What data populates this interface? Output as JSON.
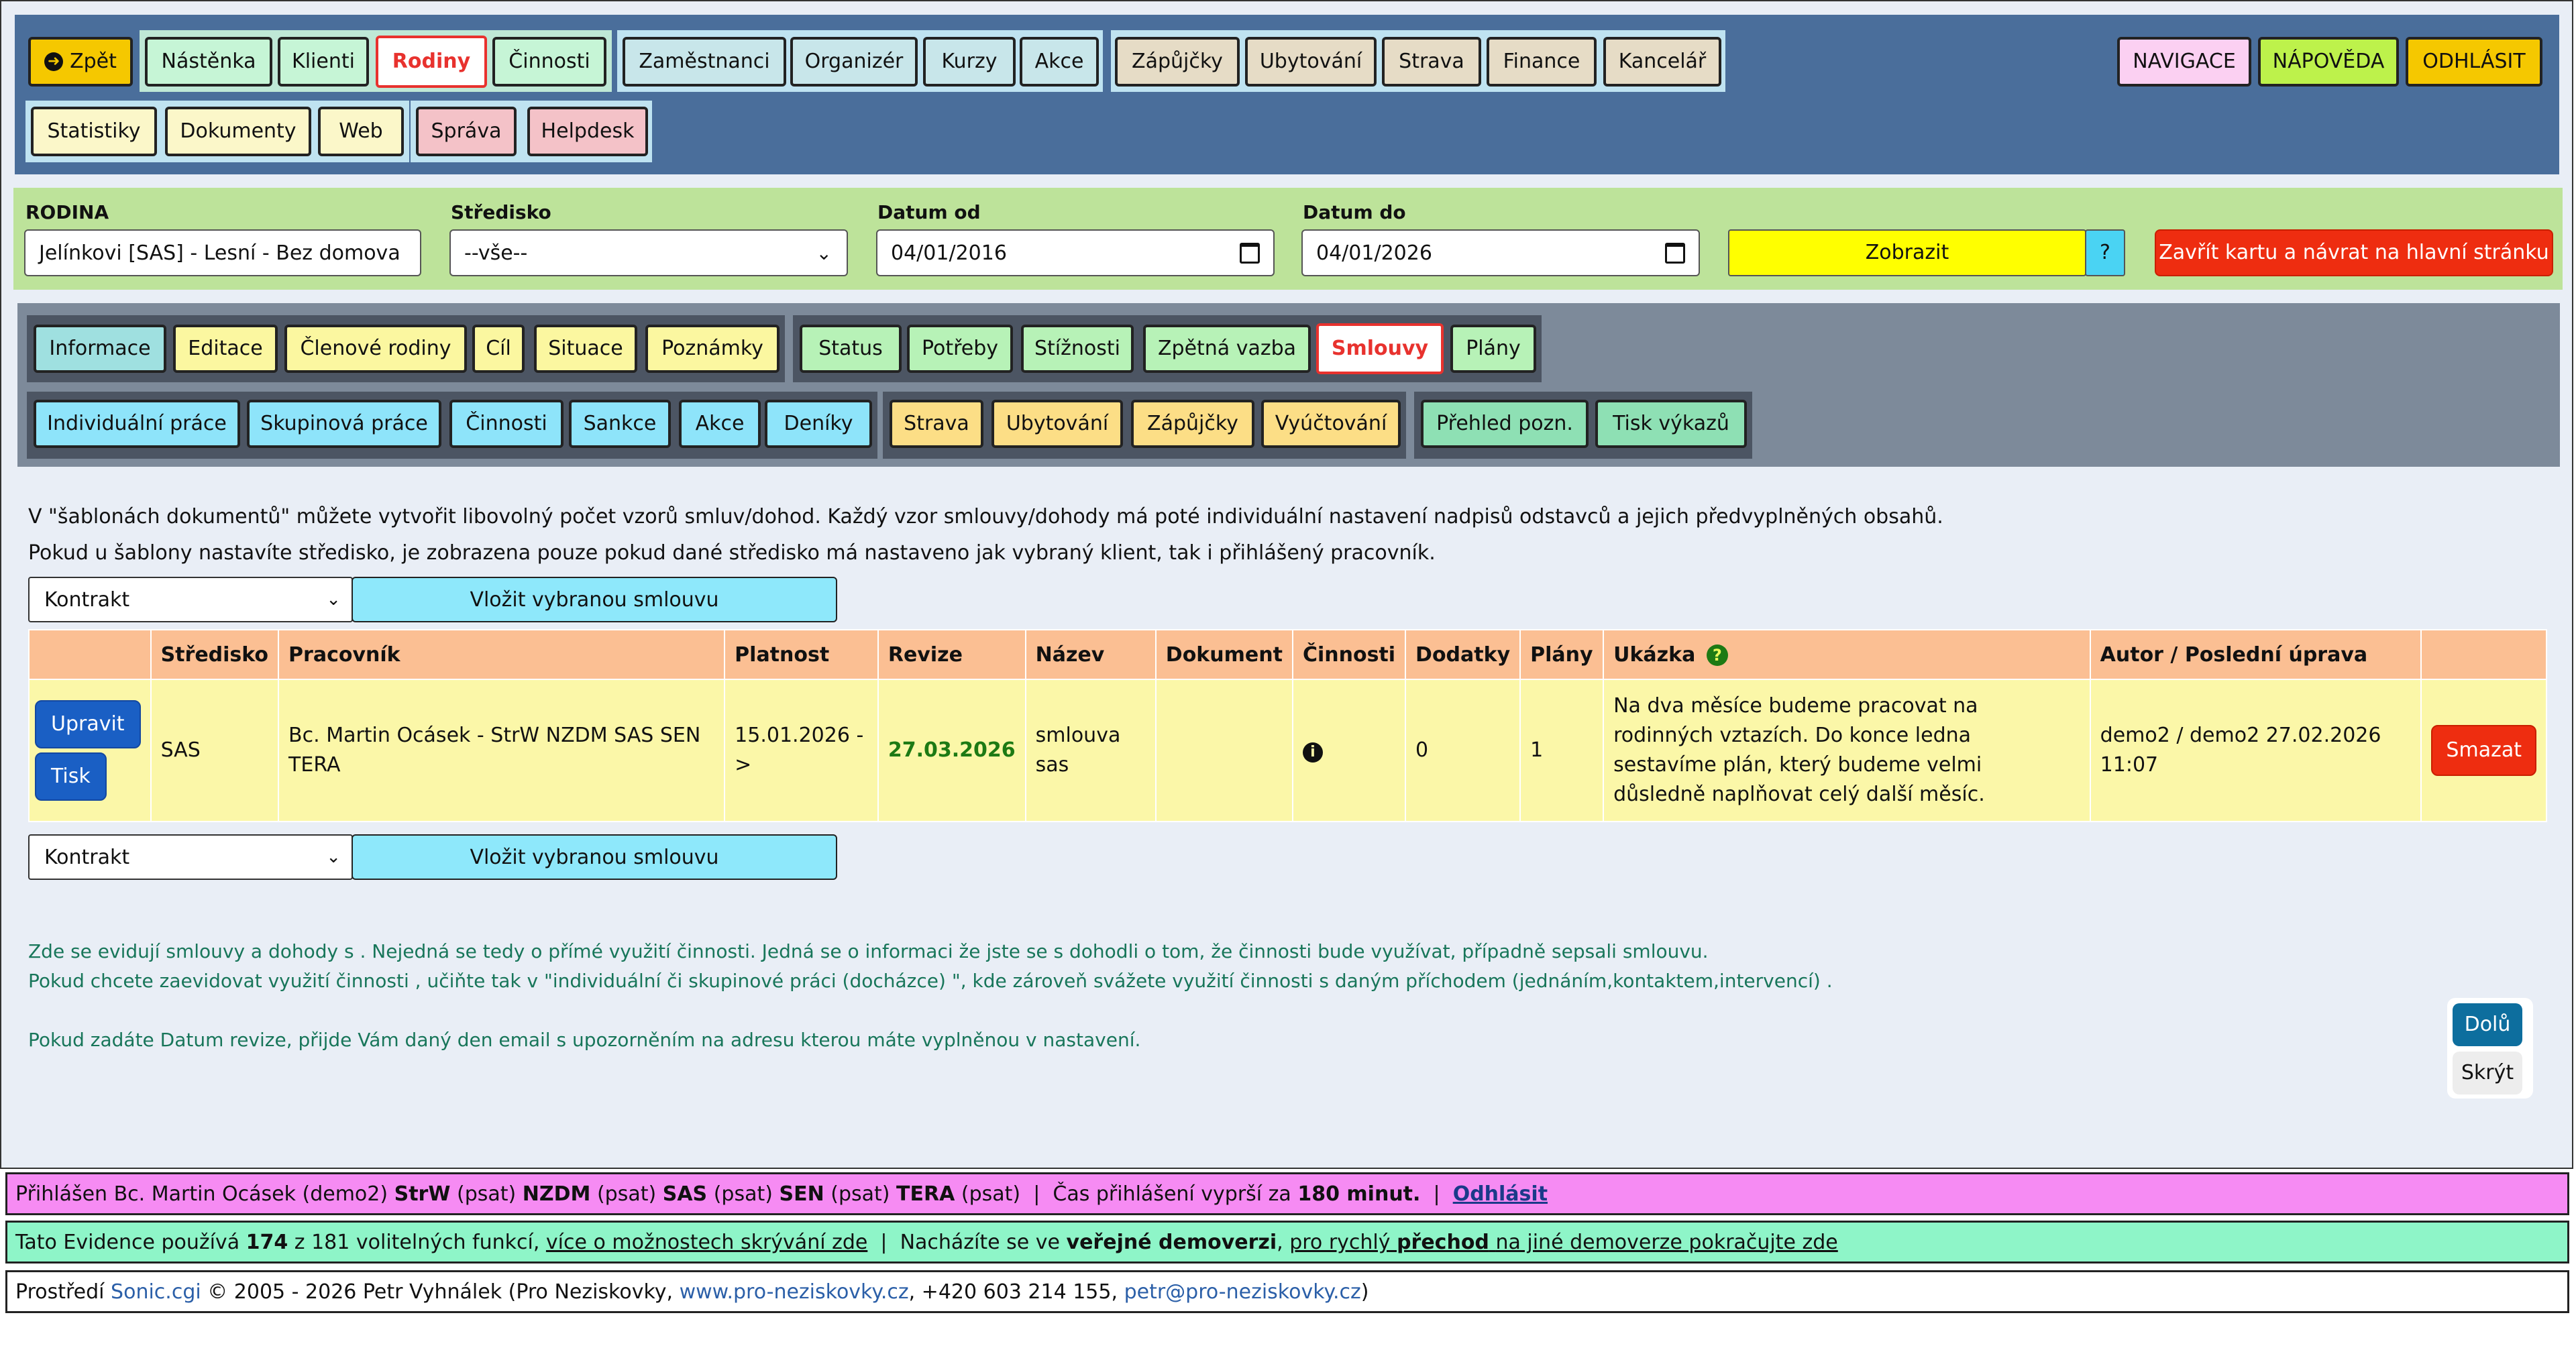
{
  "colors": {
    "nav_bg": "#4a6e9b",
    "filter_bg": "#bde39a",
    "tab_bg": "#7d8a9a",
    "active_red": "#e8322e",
    "table_head": "#fbbf93",
    "table_row": "#fbf7a8"
  },
  "topnav": {
    "back": "Zpět",
    "group1": [
      "Nástěnka",
      "Klienti",
      "Rodiny",
      "Činnosti"
    ],
    "group2": [
      "Zaměstnanci",
      "Organizér",
      "Kurzy",
      "Akce"
    ],
    "group3": [
      "Zápůjčky",
      "Ubytování",
      "Strava",
      "Finance",
      "Kancelář"
    ],
    "group4": [
      "Statistiky",
      "Dokumenty",
      "Web"
    ],
    "group5": [
      "Správa",
      "Helpdesk"
    ],
    "right": [
      "NAVIGACE",
      "NÁPOVĚDA",
      "ODHLÁSIT"
    ]
  },
  "filter": {
    "family_label": "RODINA",
    "family_value": "Jelínkovi [SAS] - Lesní - Bez domova",
    "center_label": "Středisko",
    "center_value": "--vše--",
    "date_from_label": "Datum od",
    "date_from_value": "04/01/2016",
    "date_to_label": "Datum do",
    "date_to_value": "04/01/2026",
    "show_button": "Zobrazit",
    "help_button": "?",
    "close_button": "Zavřít kartu a návrat na hlavní stránku"
  },
  "tabs": {
    "row1_a": [
      "Informace",
      "Editace",
      "Členové rodiny",
      "Cíl",
      "Situace",
      "Poznámky"
    ],
    "row1_b": [
      "Status",
      "Potřeby",
      "Stížnosti",
      "Zpětná vazba",
      "Smlouvy",
      "Plány"
    ],
    "row2_a": [
      "Individuální práce",
      "Skupinová práce",
      "Činnosti",
      "Sankce",
      "Akce",
      "Deníky"
    ],
    "row2_b": [
      "Strava",
      "Ubytování",
      "Zápůjčky",
      "Vyúčtování"
    ],
    "row2_c": [
      "Přehled pozn.",
      "Tisk výkazů"
    ]
  },
  "intro": {
    "line1": "V \"šablonách dokumentů\" můžete vytvořit libovolný počet vzorů smluv/dohod. Každý vzor smlouvy/dohody má poté individuální nastavení nadpisů odstavců a jejich předvyplněných obsahů.",
    "line2": "Pokud u šablony nastavíte středisko, je zobrazena pouze pokud dané středisko má nastaveno jak vybraný klient, tak i přihlášený pracovník."
  },
  "contract_select": {
    "value": "Kontrakt",
    "insert": "Vložit vybranou smlouvu"
  },
  "table": {
    "headers": [
      "",
      "Středisko",
      "Pracovník",
      "Platnost",
      "Revize",
      "Název",
      "Dokument",
      "Činnosti",
      "Dodatky",
      "Plány",
      "Ukázka",
      "Autor / Poslední úprava",
      ""
    ],
    "row": {
      "edit": "Upravit",
      "print": "Tisk",
      "center": "SAS",
      "worker": "Bc. Martin Ocásek - StrW NZDM SAS SEN TERA",
      "validity": "15.01.2026 - >",
      "revision": "27.03.2026",
      "name": "smlouva sas",
      "document": "",
      "addenda": "0",
      "plans": "1",
      "preview": "Na dva měsíce budeme pracovat na rodinných vztazích. Do konce ledna sestavíme plán, který budeme velmi důsledně naplňovat celý další měsíc.",
      "author": "demo2 / demo2 27.02.2026 11:07",
      "delete": "Smazat"
    }
  },
  "notes": {
    "n1": "Zde se evidují smlouvy a dohody s . Nejedná se tedy o přímé využití činnosti. Jedná se o informaci že jste se s dohodli o tom, že činnosti bude využívat, případně sepsali smlouvu.",
    "n2": "Pokud chcete zaevidovat využití činnosti , učiňte tak v \"individuální či skupinové práci (docházce) \", kde zároveň svážete využití činnosti s daným příchodem (jednáním,kontaktem,intervencí) .",
    "n3": "Pokud zadáte Datum revize, přijde Vám daný den email s upozorněním na adresu kterou máte vyplněnou v nastavení."
  },
  "side": {
    "down": "Dolů",
    "hide": "Skrýt"
  },
  "footer": {
    "login_pre": "Přihlášen Bc. Martin Ocásek (demo2)",
    "roles": [
      {
        "b": "StrW",
        "t": "(psat)"
      },
      {
        "b": "NZDM",
        "t": "(psat)"
      },
      {
        "b": "SAS",
        "t": "(psat)"
      },
      {
        "b": "SEN",
        "t": "(psat)"
      },
      {
        "b": "TERA",
        "t": "(psat)"
      }
    ],
    "sep": "|",
    "expire_pre": "Čas přihlášení vyprší za",
    "expire_val": "180 minut.",
    "logout": "Odhlásit",
    "line2_pre": "Tato Evidence používá",
    "line2_count": "174",
    "line2_mid": "z 181 volitelných funkcí,",
    "line2_link": "více o možnostech skrývání zde",
    "line2_mid2": "Nacházíte se ve",
    "line2_bold": "veřejné demoverzi",
    "line2_link2a": "pro rychlý",
    "line2_link2b": "přechod",
    "line2_link2c": "na jiné demoverze pokračujte zde",
    "line3_pre": "Prostředí",
    "line3_sonic": "Sonic.cgi",
    "line3_mid": "© 2005 - 2026 Petr Vyhnálek (Pro Neziskovky,",
    "line3_web": "www.pro-neziskovky.cz",
    "line3_phone": ", +420 603 214 155,",
    "line3_mail": "petr@pro-neziskovky.cz",
    "line3_end": ")"
  }
}
